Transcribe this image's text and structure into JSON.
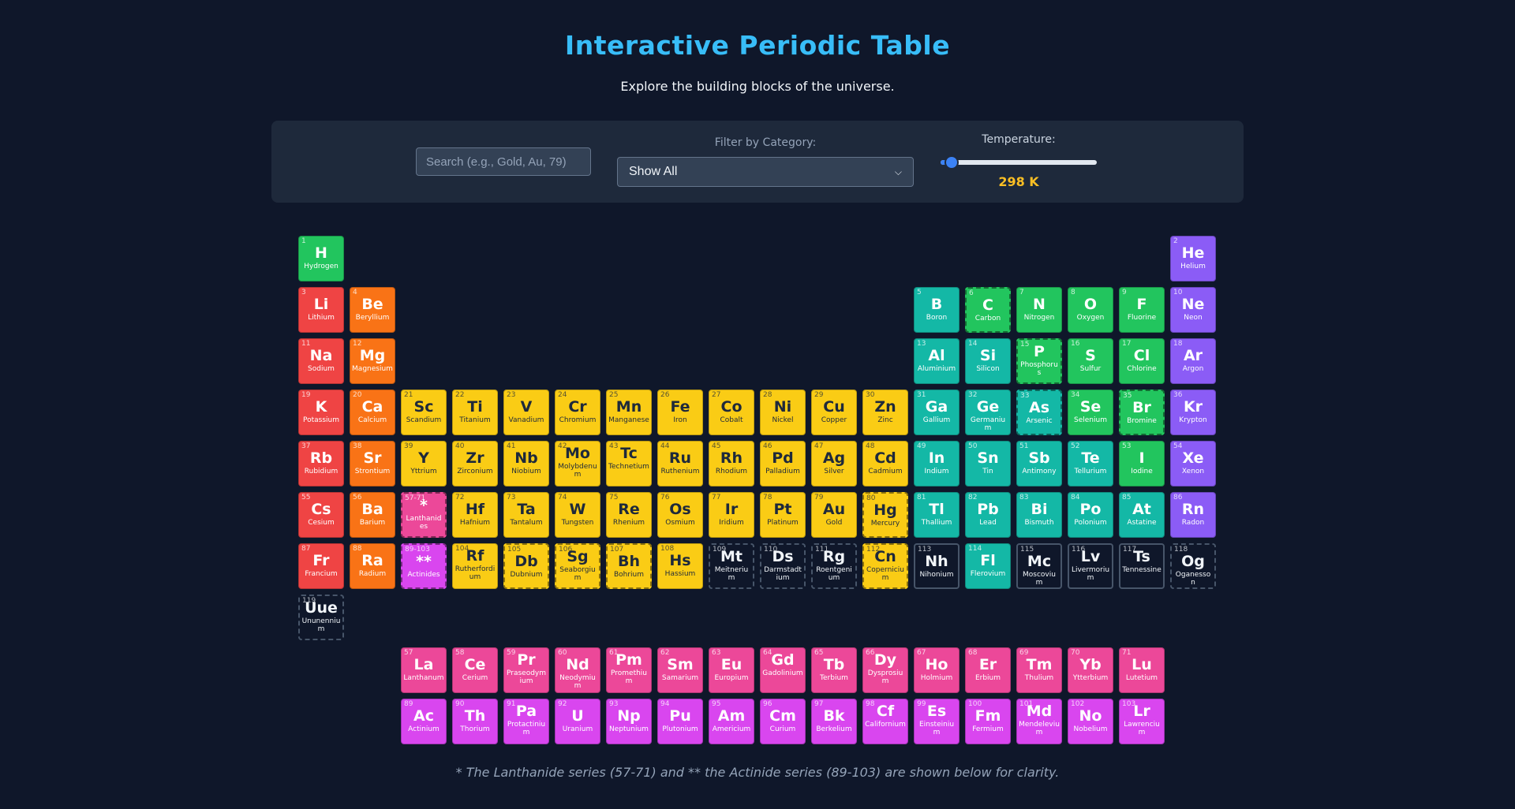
{
  "header": {
    "title": "Interactive Periodic Table",
    "subtitle": "Explore the building blocks of the universe."
  },
  "controls": {
    "search_placeholder": "Search (e.g., Gold, Au, 79)",
    "filter_label": "Filter by Category:",
    "filter_value": "Show All",
    "temperature_label": "Temperature:",
    "temperature_value": "298 K",
    "temperature_fraction": 0.07
  },
  "colors": {
    "alkali": "#ef4444",
    "alkaline": "#f97316",
    "transition": "#facc15",
    "post": "#14b8a6",
    "metalloid": "#14b8a6",
    "nonmetal": "#22c55e",
    "noble": "#8b5cf6",
    "lanthanide": "#ec4899",
    "actinide": "#d946ef",
    "unknown": "#0f172a"
  },
  "elements": [
    {
      "n": "1",
      "s": "H",
      "name": "Hydrogen",
      "cat": "nonmetal",
      "r": 1,
      "c": 1
    },
    {
      "n": "2",
      "s": "He",
      "name": "Helium",
      "cat": "noble",
      "r": 1,
      "c": 18
    },
    {
      "n": "3",
      "s": "Li",
      "name": "Lithium",
      "cat": "alkali",
      "r": 2,
      "c": 1
    },
    {
      "n": "4",
      "s": "Be",
      "name": "Beryllium",
      "cat": "alkaline",
      "r": 2,
      "c": 2
    },
    {
      "n": "5",
      "s": "B",
      "name": "Boron",
      "cat": "metalloid",
      "r": 2,
      "c": 13
    },
    {
      "n": "6",
      "s": "C",
      "name": "Carbon",
      "cat": "nonmetal",
      "r": 2,
      "c": 14,
      "st": "dashed"
    },
    {
      "n": "7",
      "s": "N",
      "name": "Nitrogen",
      "cat": "nonmetal",
      "r": 2,
      "c": 15
    },
    {
      "n": "8",
      "s": "O",
      "name": "Oxygen",
      "cat": "nonmetal",
      "r": 2,
      "c": 16
    },
    {
      "n": "9",
      "s": "F",
      "name": "Fluorine",
      "cat": "nonmetal",
      "r": 2,
      "c": 17
    },
    {
      "n": "10",
      "s": "Ne",
      "name": "Neon",
      "cat": "noble",
      "r": 2,
      "c": 18
    },
    {
      "n": "11",
      "s": "Na",
      "name": "Sodium",
      "cat": "alkali",
      "r": 3,
      "c": 1
    },
    {
      "n": "12",
      "s": "Mg",
      "name": "Magnesium",
      "cat": "alkaline",
      "r": 3,
      "c": 2
    },
    {
      "n": "13",
      "s": "Al",
      "name": "Aluminium",
      "cat": "post",
      "r": 3,
      "c": 13
    },
    {
      "n": "14",
      "s": "Si",
      "name": "Silicon",
      "cat": "metalloid",
      "r": 3,
      "c": 14
    },
    {
      "n": "15",
      "s": "P",
      "name": "Phosphorus",
      "cat": "nonmetal",
      "r": 3,
      "c": 15,
      "st": "dashed"
    },
    {
      "n": "16",
      "s": "S",
      "name": "Sulfur",
      "cat": "nonmetal",
      "r": 3,
      "c": 16
    },
    {
      "n": "17",
      "s": "Cl",
      "name": "Chlorine",
      "cat": "nonmetal",
      "r": 3,
      "c": 17
    },
    {
      "n": "18",
      "s": "Ar",
      "name": "Argon",
      "cat": "noble",
      "r": 3,
      "c": 18
    },
    {
      "n": "19",
      "s": "K",
      "name": "Potassium",
      "cat": "alkali",
      "r": 4,
      "c": 1
    },
    {
      "n": "20",
      "s": "Ca",
      "name": "Calcium",
      "cat": "alkaline",
      "r": 4,
      "c": 2
    },
    {
      "n": "21",
      "s": "Sc",
      "name": "Scandium",
      "cat": "transition",
      "r": 4,
      "c": 3
    },
    {
      "n": "22",
      "s": "Ti",
      "name": "Titanium",
      "cat": "transition",
      "r": 4,
      "c": 4
    },
    {
      "n": "23",
      "s": "V",
      "name": "Vanadium",
      "cat": "transition",
      "r": 4,
      "c": 5
    },
    {
      "n": "24",
      "s": "Cr",
      "name": "Chromium",
      "cat": "transition",
      "r": 4,
      "c": 6
    },
    {
      "n": "25",
      "s": "Mn",
      "name": "Manganese",
      "cat": "transition",
      "r": 4,
      "c": 7
    },
    {
      "n": "26",
      "s": "Fe",
      "name": "Iron",
      "cat": "transition",
      "r": 4,
      "c": 8
    },
    {
      "n": "27",
      "s": "Co",
      "name": "Cobalt",
      "cat": "transition",
      "r": 4,
      "c": 9
    },
    {
      "n": "28",
      "s": "Ni",
      "name": "Nickel",
      "cat": "transition",
      "r": 4,
      "c": 10
    },
    {
      "n": "29",
      "s": "Cu",
      "name": "Copper",
      "cat": "transition",
      "r": 4,
      "c": 11
    },
    {
      "n": "30",
      "s": "Zn",
      "name": "Zinc",
      "cat": "transition",
      "r": 4,
      "c": 12
    },
    {
      "n": "31",
      "s": "Ga",
      "name": "Gallium",
      "cat": "post",
      "r": 4,
      "c": 13
    },
    {
      "n": "32",
      "s": "Ge",
      "name": "Germanium",
      "cat": "metalloid",
      "r": 4,
      "c": 14
    },
    {
      "n": "33",
      "s": "As",
      "name": "Arsenic",
      "cat": "metalloid",
      "r": 4,
      "c": 15,
      "st": "dashed"
    },
    {
      "n": "34",
      "s": "Se",
      "name": "Selenium",
      "cat": "nonmetal",
      "r": 4,
      "c": 16
    },
    {
      "n": "35",
      "s": "Br",
      "name": "Bromine",
      "cat": "nonmetal",
      "r": 4,
      "c": 17,
      "st": "dashed"
    },
    {
      "n": "36",
      "s": "Kr",
      "name": "Krypton",
      "cat": "noble",
      "r": 4,
      "c": 18
    },
    {
      "n": "37",
      "s": "Rb",
      "name": "Rubidium",
      "cat": "alkali",
      "r": 5,
      "c": 1
    },
    {
      "n": "38",
      "s": "Sr",
      "name": "Strontium",
      "cat": "alkaline",
      "r": 5,
      "c": 2
    },
    {
      "n": "39",
      "s": "Y",
      "name": "Yttrium",
      "cat": "transition",
      "r": 5,
      "c": 3
    },
    {
      "n": "40",
      "s": "Zr",
      "name": "Zirconium",
      "cat": "transition",
      "r": 5,
      "c": 4
    },
    {
      "n": "41",
      "s": "Nb",
      "name": "Niobium",
      "cat": "transition",
      "r": 5,
      "c": 5
    },
    {
      "n": "42",
      "s": "Mo",
      "name": "Molybdenum",
      "cat": "transition",
      "r": 5,
      "c": 6
    },
    {
      "n": "43",
      "s": "Tc",
      "name": "Technetium",
      "cat": "transition",
      "r": 5,
      "c": 7
    },
    {
      "n": "44",
      "s": "Ru",
      "name": "Ruthenium",
      "cat": "transition",
      "r": 5,
      "c": 8
    },
    {
      "n": "45",
      "s": "Rh",
      "name": "Rhodium",
      "cat": "transition",
      "r": 5,
      "c": 9
    },
    {
      "n": "46",
      "s": "Pd",
      "name": "Palladium",
      "cat": "transition",
      "r": 5,
      "c": 10
    },
    {
      "n": "47",
      "s": "Ag",
      "name": "Silver",
      "cat": "transition",
      "r": 5,
      "c": 11
    },
    {
      "n": "48",
      "s": "Cd",
      "name": "Cadmium",
      "cat": "transition",
      "r": 5,
      "c": 12
    },
    {
      "n": "49",
      "s": "In",
      "name": "Indium",
      "cat": "post",
      "r": 5,
      "c": 13
    },
    {
      "n": "50",
      "s": "Sn",
      "name": "Tin",
      "cat": "post",
      "r": 5,
      "c": 14
    },
    {
      "n": "51",
      "s": "Sb",
      "name": "Antimony",
      "cat": "metalloid",
      "r": 5,
      "c": 15
    },
    {
      "n": "52",
      "s": "Te",
      "name": "Tellurium",
      "cat": "metalloid",
      "r": 5,
      "c": 16
    },
    {
      "n": "53",
      "s": "I",
      "name": "Iodine",
      "cat": "nonmetal",
      "r": 5,
      "c": 17
    },
    {
      "n": "54",
      "s": "Xe",
      "name": "Xenon",
      "cat": "noble",
      "r": 5,
      "c": 18
    },
    {
      "n": "55",
      "s": "Cs",
      "name": "Cesium",
      "cat": "alkali",
      "r": 6,
      "c": 1
    },
    {
      "n": "56",
      "s": "Ba",
      "name": "Barium",
      "cat": "alkaline",
      "r": 6,
      "c": 2
    },
    {
      "n": "57-71",
      "s": "*",
      "name": "Lanthanides",
      "cat": "lanthanide",
      "r": 6,
      "c": 3,
      "st": "dashed"
    },
    {
      "n": "72",
      "s": "Hf",
      "name": "Hafnium",
      "cat": "transition",
      "r": 6,
      "c": 4
    },
    {
      "n": "73",
      "s": "Ta",
      "name": "Tantalum",
      "cat": "transition",
      "r": 6,
      "c": 5
    },
    {
      "n": "74",
      "s": "W",
      "name": "Tungsten",
      "cat": "transition",
      "r": 6,
      "c": 6
    },
    {
      "n": "75",
      "s": "Re",
      "name": "Rhenium",
      "cat": "transition",
      "r": 6,
      "c": 7
    },
    {
      "n": "76",
      "s": "Os",
      "name": "Osmium",
      "cat": "transition",
      "r": 6,
      "c": 8
    },
    {
      "n": "77",
      "s": "Ir",
      "name": "Iridium",
      "cat": "transition",
      "r": 6,
      "c": 9
    },
    {
      "n": "78",
      "s": "Pt",
      "name": "Platinum",
      "cat": "transition",
      "r": 6,
      "c": 10
    },
    {
      "n": "79",
      "s": "Au",
      "name": "Gold",
      "cat": "transition",
      "r": 6,
      "c": 11
    },
    {
      "n": "80",
      "s": "Hg",
      "name": "Mercury",
      "cat": "transition",
      "r": 6,
      "c": 12,
      "st": "dashed"
    },
    {
      "n": "81",
      "s": "Tl",
      "name": "Thallium",
      "cat": "post",
      "r": 6,
      "c": 13
    },
    {
      "n": "82",
      "s": "Pb",
      "name": "Lead",
      "cat": "post",
      "r": 6,
      "c": 14
    },
    {
      "n": "83",
      "s": "Bi",
      "name": "Bismuth",
      "cat": "post",
      "r": 6,
      "c": 15
    },
    {
      "n": "84",
      "s": "Po",
      "name": "Polonium",
      "cat": "post",
      "r": 6,
      "c": 16
    },
    {
      "n": "85",
      "s": "At",
      "name": "Astatine",
      "cat": "metalloid",
      "r": 6,
      "c": 17
    },
    {
      "n": "86",
      "s": "Rn",
      "name": "Radon",
      "cat": "noble",
      "r": 6,
      "c": 18
    },
    {
      "n": "87",
      "s": "Fr",
      "name": "Francium",
      "cat": "alkali",
      "r": 7,
      "c": 1
    },
    {
      "n": "88",
      "s": "Ra",
      "name": "Radium",
      "cat": "alkaline",
      "r": 7,
      "c": 2
    },
    {
      "n": "89-103",
      "s": "**",
      "name": "Actinides",
      "cat": "actinide",
      "r": 7,
      "c": 3,
      "st": "dashed"
    },
    {
      "n": "104",
      "s": "Rf",
      "name": "Rutherfordium",
      "cat": "transition",
      "r": 7,
      "c": 4
    },
    {
      "n": "105",
      "s": "Db",
      "name": "Dubnium",
      "cat": "transition",
      "r": 7,
      "c": 5,
      "st": "dashed"
    },
    {
      "n": "106",
      "s": "Sg",
      "name": "Seaborgium",
      "cat": "transition",
      "r": 7,
      "c": 6,
      "st": "dashed"
    },
    {
      "n": "107",
      "s": "Bh",
      "name": "Bohrium",
      "cat": "transition",
      "r": 7,
      "c": 7,
      "st": "dashed"
    },
    {
      "n": "108",
      "s": "Hs",
      "name": "Hassium",
      "cat": "transition",
      "r": 7,
      "c": 8
    },
    {
      "n": "109",
      "s": "Mt",
      "name": "Meitnerium",
      "cat": "unknown",
      "r": 7,
      "c": 9,
      "st": "dark"
    },
    {
      "n": "110",
      "s": "Ds",
      "name": "Darmstadtium",
      "cat": "unknown",
      "r": 7,
      "c": 10,
      "st": "dark"
    },
    {
      "n": "111",
      "s": "Rg",
      "name": "Roentgenium",
      "cat": "unknown",
      "r": 7,
      "c": 11,
      "st": "dark"
    },
    {
      "n": "112",
      "s": "Cn",
      "name": "Copernicium",
      "cat": "transition",
      "r": 7,
      "c": 12,
      "st": "dashed"
    },
    {
      "n": "113",
      "s": "Nh",
      "name": "Nihonium",
      "cat": "unknown",
      "r": 7,
      "c": 13,
      "st": "dark solid"
    },
    {
      "n": "114",
      "s": "Fl",
      "name": "Flerovium",
      "cat": "post",
      "r": 7,
      "c": 14
    },
    {
      "n": "115",
      "s": "Mc",
      "name": "Moscovium",
      "cat": "unknown",
      "r": 7,
      "c": 15,
      "st": "dark solid"
    },
    {
      "n": "116",
      "s": "Lv",
      "name": "Livermorium",
      "cat": "unknown",
      "r": 7,
      "c": 16,
      "st": "dark solid"
    },
    {
      "n": "117",
      "s": "Ts",
      "name": "Tennessine",
      "cat": "unknown",
      "r": 7,
      "c": 17,
      "st": "dark solid"
    },
    {
      "n": "118",
      "s": "Og",
      "name": "Oganesson",
      "cat": "unknown",
      "r": 7,
      "c": 18,
      "st": "dark"
    },
    {
      "n": "119",
      "s": "Uue",
      "name": "Ununennium",
      "cat": "unknown",
      "r": 8,
      "c": 1,
      "st": "dark"
    },
    {
      "n": "57",
      "s": "La",
      "name": "Lanthanum",
      "cat": "lanthanide",
      "r": 9,
      "c": 3
    },
    {
      "n": "58",
      "s": "Ce",
      "name": "Cerium",
      "cat": "lanthanide",
      "r": 9,
      "c": 4
    },
    {
      "n": "59",
      "s": "Pr",
      "name": "Praseodymium",
      "cat": "lanthanide",
      "r": 9,
      "c": 5
    },
    {
      "n": "60",
      "s": "Nd",
      "name": "Neodymium",
      "cat": "lanthanide",
      "r": 9,
      "c": 6
    },
    {
      "n": "61",
      "s": "Pm",
      "name": "Promethium",
      "cat": "lanthanide",
      "r": 9,
      "c": 7
    },
    {
      "n": "62",
      "s": "Sm",
      "name": "Samarium",
      "cat": "lanthanide",
      "r": 9,
      "c": 8
    },
    {
      "n": "63",
      "s": "Eu",
      "name": "Europium",
      "cat": "lanthanide",
      "r": 9,
      "c": 9
    },
    {
      "n": "64",
      "s": "Gd",
      "name": "Gadolinium",
      "cat": "lanthanide",
      "r": 9,
      "c": 10
    },
    {
      "n": "65",
      "s": "Tb",
      "name": "Terbium",
      "cat": "lanthanide",
      "r": 9,
      "c": 11
    },
    {
      "n": "66",
      "s": "Dy",
      "name": "Dysprosium",
      "cat": "lanthanide",
      "r": 9,
      "c": 12
    },
    {
      "n": "67",
      "s": "Ho",
      "name": "Holmium",
      "cat": "lanthanide",
      "r": 9,
      "c": 13
    },
    {
      "n": "68",
      "s": "Er",
      "name": "Erbium",
      "cat": "lanthanide",
      "r": 9,
      "c": 14
    },
    {
      "n": "69",
      "s": "Tm",
      "name": "Thulium",
      "cat": "lanthanide",
      "r": 9,
      "c": 15
    },
    {
      "n": "70",
      "s": "Yb",
      "name": "Ytterbium",
      "cat": "lanthanide",
      "r": 9,
      "c": 16
    },
    {
      "n": "71",
      "s": "Lu",
      "name": "Lutetium",
      "cat": "lanthanide",
      "r": 9,
      "c": 17
    },
    {
      "n": "89",
      "s": "Ac",
      "name": "Actinium",
      "cat": "actinide",
      "r": 10,
      "c": 3
    },
    {
      "n": "90",
      "s": "Th",
      "name": "Thorium",
      "cat": "actinide",
      "r": 10,
      "c": 4
    },
    {
      "n": "91",
      "s": "Pa",
      "name": "Protactinium",
      "cat": "actinide",
      "r": 10,
      "c": 5
    },
    {
      "n": "92",
      "s": "U",
      "name": "Uranium",
      "cat": "actinide",
      "r": 10,
      "c": 6
    },
    {
      "n": "93",
      "s": "Np",
      "name": "Neptunium",
      "cat": "actinide",
      "r": 10,
      "c": 7
    },
    {
      "n": "94",
      "s": "Pu",
      "name": "Plutonium",
      "cat": "actinide",
      "r": 10,
      "c": 8
    },
    {
      "n": "95",
      "s": "Am",
      "name": "Americium",
      "cat": "actinide",
      "r": 10,
      "c": 9
    },
    {
      "n": "96",
      "s": "Cm",
      "name": "Curium",
      "cat": "actinide",
      "r": 10,
      "c": 10
    },
    {
      "n": "97",
      "s": "Bk",
      "name": "Berkelium",
      "cat": "actinide",
      "r": 10,
      "c": 11
    },
    {
      "n": "98",
      "s": "Cf",
      "name": "Californium",
      "cat": "actinide",
      "r": 10,
      "c": 12
    },
    {
      "n": "99",
      "s": "Es",
      "name": "Einsteinium",
      "cat": "actinide",
      "r": 10,
      "c": 13
    },
    {
      "n": "100",
      "s": "Fm",
      "name": "Fermium",
      "cat": "actinide",
      "r": 10,
      "c": 14
    },
    {
      "n": "101",
      "s": "Md",
      "name": "Mendelevium",
      "cat": "actinide",
      "r": 10,
      "c": 15
    },
    {
      "n": "102",
      "s": "No",
      "name": "Nobelium",
      "cat": "actinide",
      "r": 10,
      "c": 16
    },
    {
      "n": "103",
      "s": "Lr",
      "name": "Lawrencium",
      "cat": "actinide",
      "r": 10,
      "c": 17
    }
  ],
  "footnote": "* The Lanthanide series (57-71) and ** the Actinide series (89-103) are shown below for clarity."
}
